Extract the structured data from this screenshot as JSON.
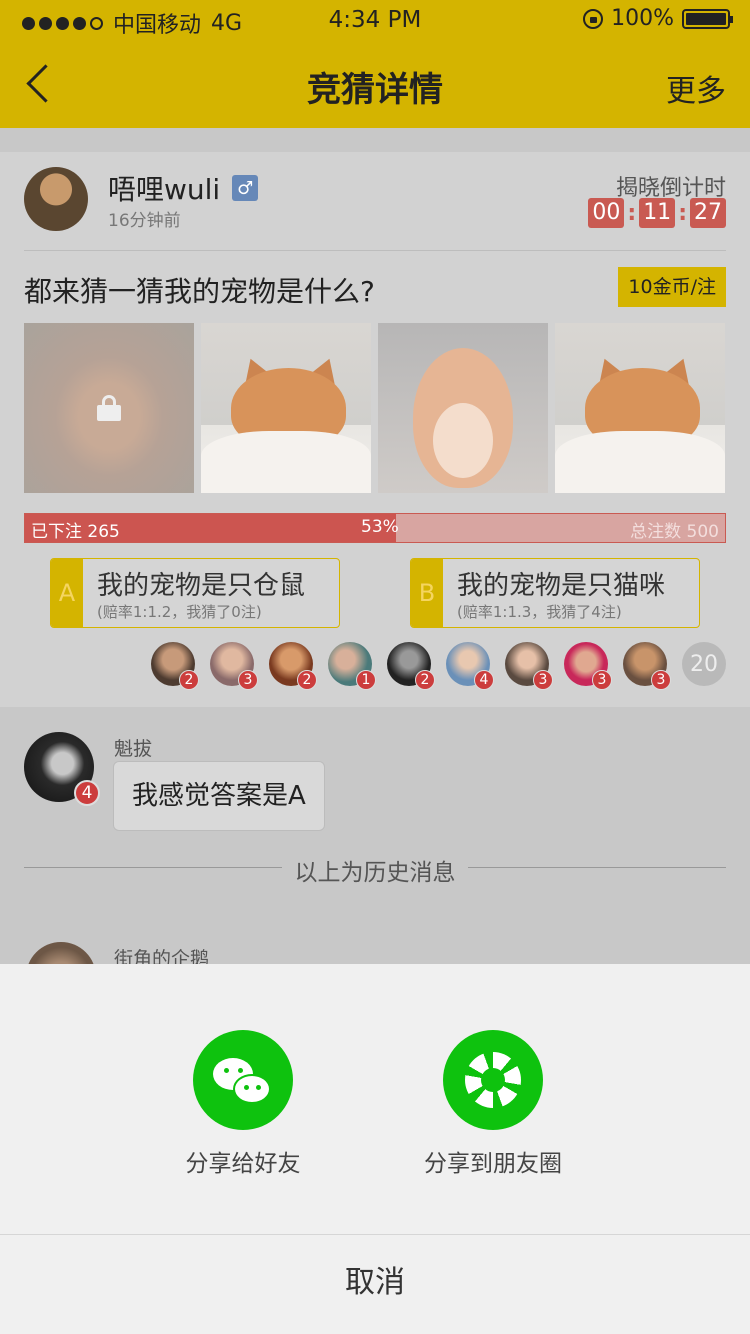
{
  "status_bar": {
    "carrier": "中国移动",
    "network": "4G",
    "time": "4:34 PM",
    "battery": "100%"
  },
  "nav": {
    "title": "竞猜详情",
    "more": "更多"
  },
  "post": {
    "username": "唔哩wuli",
    "gender_symbol": "♂",
    "time_ago": "16分钟前",
    "countdown_label": "揭晓倒计时",
    "countdown": [
      "00",
      "11",
      "27"
    ],
    "question": "都来猜一猜我的宠物是什么?",
    "coin_tag": "10金币/注"
  },
  "progress": {
    "placed_label": "已下注 265",
    "percent_label": "53%",
    "percent": 53,
    "total_label": "总注数 500"
  },
  "options": [
    {
      "letter": "A",
      "title": "我的宠物是只仓鼠",
      "sub": "(赔率1:1.2，我猜了0注)"
    },
    {
      "letter": "B",
      "title": "我的宠物是只猫咪",
      "sub": "(赔率1:1.3，我猜了4注)"
    }
  ],
  "voters": {
    "badges": [
      "2",
      "3",
      "2",
      "1",
      "2",
      "4",
      "3",
      "3",
      "3"
    ],
    "count": "20"
  },
  "messages": {
    "first": {
      "name": "魁拔",
      "badge": "4",
      "text": "我感觉答案是A"
    },
    "history_divider": "以上为历史消息",
    "second": {
      "name": "街角的企鹅"
    }
  },
  "share_sheet": {
    "friend_label": "分享给好友",
    "moments_label": "分享到朋友圈",
    "cancel": "取消"
  },
  "colors": {
    "accent": "#d4b400",
    "countdown": "#c95a52",
    "progress_fill": "#cc5550",
    "wechat_green": "#0ec20e"
  },
  "icons": {
    "back": "chevron-left-icon",
    "gender": "male-icon",
    "locked_photo": "lock-icon",
    "share_friend": "wechat-icon",
    "share_moments": "moments-icon"
  }
}
